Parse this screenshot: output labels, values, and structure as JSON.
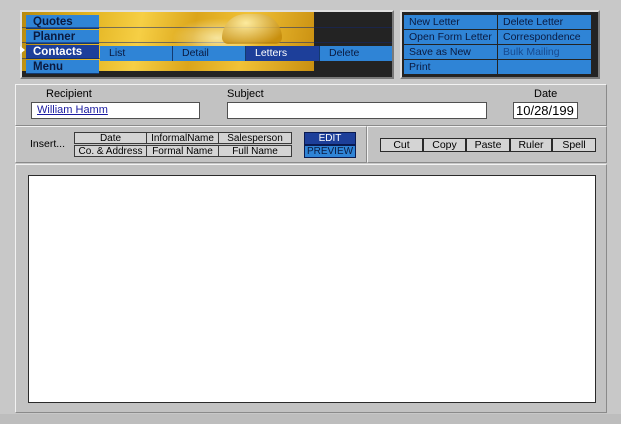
{
  "nav": {
    "items": [
      {
        "label": "Quotes",
        "active": false
      },
      {
        "label": "Planner",
        "active": false
      },
      {
        "label": "Contacts",
        "active": true
      },
      {
        "label": "Menu",
        "active": false
      }
    ],
    "subtabs": [
      {
        "label": "List",
        "active": false
      },
      {
        "label": "Detail",
        "active": false
      },
      {
        "label": "Letters",
        "active": true
      },
      {
        "label": "Delete",
        "active": false
      }
    ]
  },
  "actions": {
    "new_letter": "New Letter",
    "delete_letter": "Delete Letter",
    "open_form_letter": "Open Form Letter",
    "correspondence_log": "Correspondence Log",
    "save_as_new_form": "Save as New Form",
    "bulk_mailing": "Bulk Mailing",
    "print": "Print"
  },
  "letter": {
    "recipient_label": "Recipient",
    "recipient_value": "William Hamm",
    "subject_label": "Subject",
    "subject_value": "",
    "date_label": "Date",
    "date_value": "10/28/199"
  },
  "insert": {
    "label": "Insert...",
    "fields": [
      "Date",
      "InformalName",
      "Salesperson",
      "Co. & Address",
      "Formal Name",
      "Full Name"
    ]
  },
  "mode": {
    "edit": "EDIT",
    "preview": "PREVIEW",
    "active": "EDIT"
  },
  "tools": [
    "Cut",
    "Copy",
    "Paste",
    "Ruler",
    "Spell"
  ],
  "colors": {
    "button_blue": "#2f84d6",
    "active_blue": "#1d3f9a",
    "panel_gray": "#c2c2c2"
  }
}
